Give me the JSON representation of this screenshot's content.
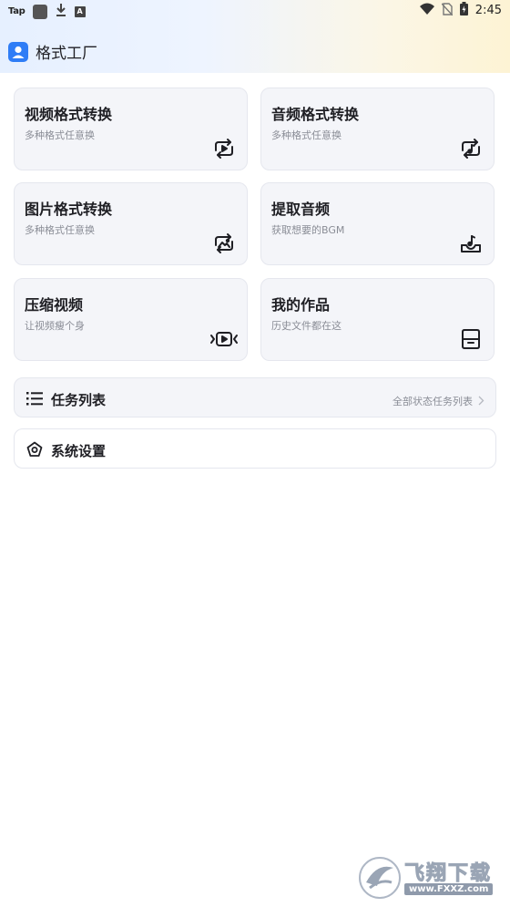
{
  "status_bar": {
    "left_label": "Tap",
    "a_icon": "A",
    "time": "2:45"
  },
  "app": {
    "title": "格式工厂"
  },
  "cards": [
    {
      "title": "视频格式转换",
      "subtitle": "多种格式任意换",
      "icon": "video-convert-icon"
    },
    {
      "title": "音频格式转换",
      "subtitle": "多种格式任意换",
      "icon": "audio-convert-icon"
    },
    {
      "title": "图片格式转换",
      "subtitle": "多种格式任意换",
      "icon": "image-convert-icon"
    },
    {
      "title": "提取音频",
      "subtitle": "获取想要的BGM",
      "icon": "extract-audio-icon"
    },
    {
      "title": "压缩视频",
      "subtitle": "让视频瘦个身",
      "icon": "compress-video-icon"
    },
    {
      "title": "我的作品",
      "subtitle": "历史文件都在这",
      "icon": "my-works-icon"
    }
  ],
  "task_list": {
    "label": "任务列表",
    "right_text": "全部状态任务列表"
  },
  "settings": {
    "label": "系统设置"
  },
  "watermark": {
    "cn": "飞翔下载",
    "en": "www.FXXZ.com"
  },
  "colors": {
    "accent": "#2f7df6",
    "card_bg": "#f4f5f9",
    "subtitle": "#8a8d96"
  }
}
